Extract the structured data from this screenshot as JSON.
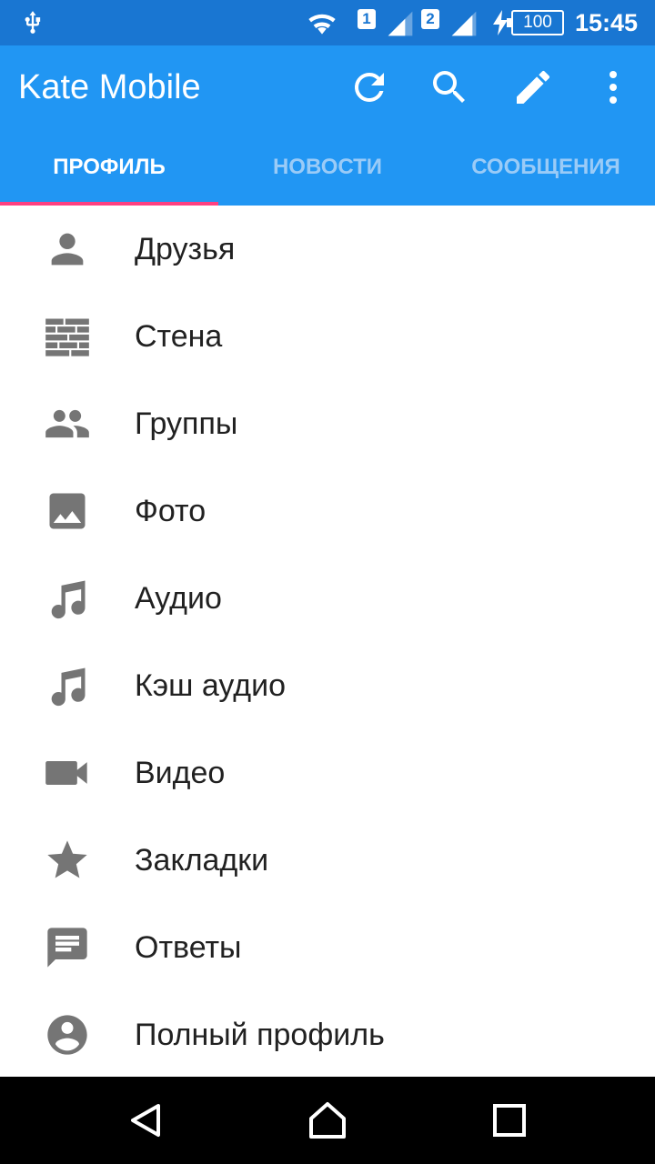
{
  "status_bar": {
    "sim1": "1",
    "sim2": "2",
    "battery": "100",
    "time": "15:45",
    "icons": [
      "usb-icon",
      "wifi-icon",
      "signal-icon",
      "charging-icon",
      "battery-icon"
    ]
  },
  "app_bar": {
    "title": "Kate Mobile",
    "actions": [
      "refresh-icon",
      "search-icon",
      "edit-icon",
      "more-vert-icon"
    ],
    "color": "#2196F3",
    "status_color": "#1976D2"
  },
  "tabs": {
    "items": [
      {
        "label": "ПРОФИЛЬ",
        "active": true
      },
      {
        "label": "НОВОСТИ",
        "active": false
      },
      {
        "label": "СООБЩЕНИЯ",
        "active": false
      }
    ],
    "indicator_color": "#FF4081"
  },
  "menu": {
    "items": [
      {
        "label": "Друзья",
        "icon": "person-icon"
      },
      {
        "label": "Стена",
        "icon": "wall-icon"
      },
      {
        "label": "Группы",
        "icon": "group-icon"
      },
      {
        "label": "Фото",
        "icon": "photo-icon"
      },
      {
        "label": "Аудио",
        "icon": "music-note-icon"
      },
      {
        "label": "Кэш аудио",
        "icon": "music-note-icon"
      },
      {
        "label": "Видео",
        "icon": "videocam-icon"
      },
      {
        "label": "Закладки",
        "icon": "star-icon"
      },
      {
        "label": "Ответы",
        "icon": "comment-icon"
      },
      {
        "label": "Полный профиль",
        "icon": "account-circle-icon"
      }
    ],
    "icon_color": "#757575"
  },
  "nav_bar": {
    "buttons": [
      "back-icon",
      "home-icon",
      "recents-icon"
    ]
  }
}
